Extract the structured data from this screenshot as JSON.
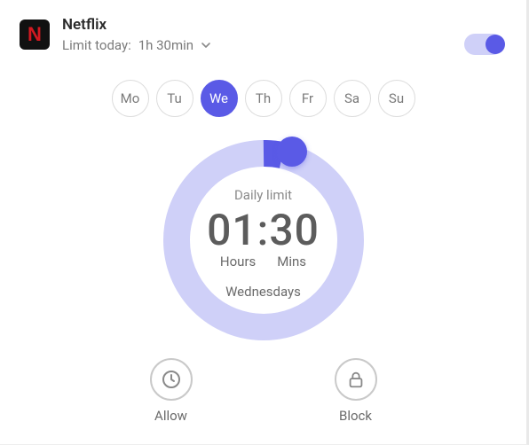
{
  "app": {
    "name": "Netflix",
    "icon_letter": "N",
    "limit_prefix": "Limit today:",
    "limit_value": "1h 30min"
  },
  "toggle": {
    "on": true
  },
  "days": [
    {
      "abbr": "Mo",
      "active": false
    },
    {
      "abbr": "Tu",
      "active": false
    },
    {
      "abbr": "We",
      "active": true
    },
    {
      "abbr": "Th",
      "active": false
    },
    {
      "abbr": "Fr",
      "active": false
    },
    {
      "abbr": "Sa",
      "active": false
    },
    {
      "abbr": "Su",
      "active": false
    }
  ],
  "dial": {
    "daily_label": "Daily limit",
    "hours": "01",
    "mins": "30",
    "sep": ":",
    "hours_label": "Hours",
    "mins_label": "Mins",
    "day_name": "Wednesdays"
  },
  "actions": {
    "allow": "Allow",
    "block": "Block"
  },
  "colors": {
    "accent": "#5a5ae6",
    "ring_bg": "#cfd0f8"
  }
}
